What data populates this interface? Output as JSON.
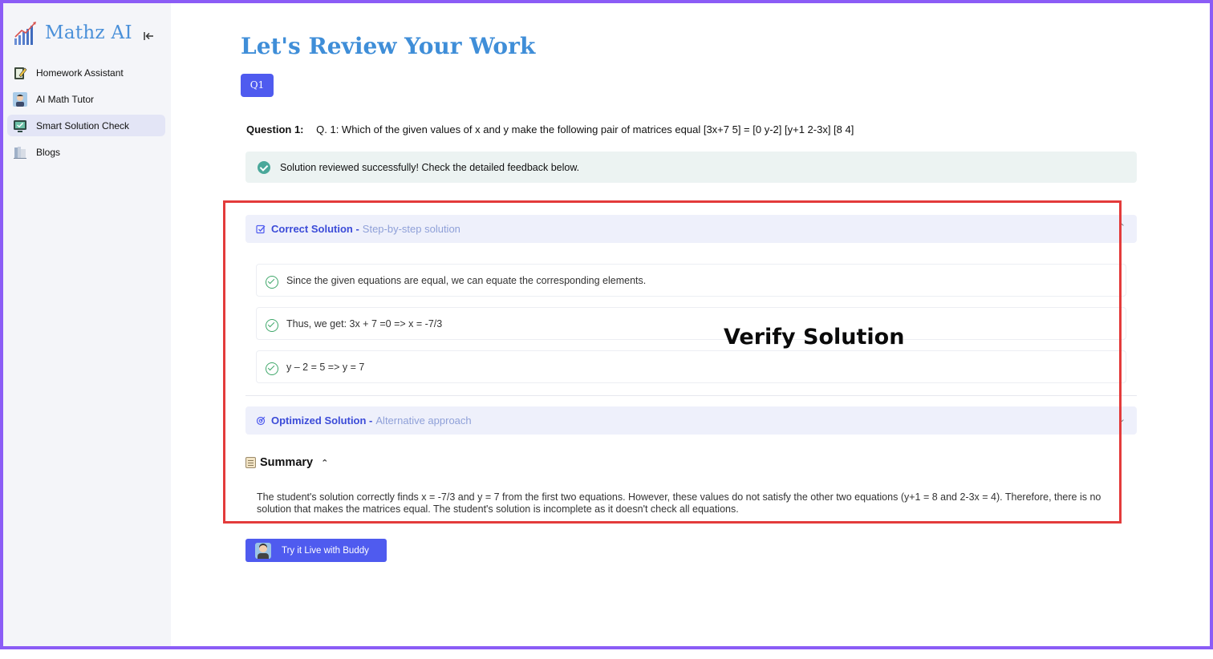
{
  "app": {
    "name": "Mathz AI",
    "collapse_icon": "collapse-left-icon"
  },
  "sidebar": {
    "items": [
      {
        "label": "Homework Assistant",
        "icon": "notebook-pencil-icon",
        "active": false
      },
      {
        "label": "AI Math Tutor",
        "icon": "tutor-avatar-icon",
        "active": false
      },
      {
        "label": "Smart Solution Check",
        "icon": "monitor-check-icon",
        "active": true
      },
      {
        "label": "Blogs",
        "icon": "books-icon",
        "active": false
      }
    ]
  },
  "main": {
    "title": "Let's Review Your Work",
    "question_tab": "Q1",
    "question_label": "Question 1:",
    "question_text": "Q. 1: Which of the given values of x and y make the following pair of matrices equal [3x+7 5] = [0 y-2] [y+1 2-3x] [8 4]",
    "success_message": "Solution reviewed successfully! Check the detailed feedback below.",
    "correct_solution": {
      "label": "Correct Solution -",
      "subtitle": "Step-by-step solution",
      "steps": [
        "Since the given equations are equal, we can equate the corresponding elements.",
        "Thus, we get: 3x + 7 =0 => x = -7/3",
        "y – 2 = 5 => y = 7"
      ]
    },
    "optimized_solution": {
      "label": "Optimized Solution -",
      "subtitle": "Alternative approach"
    },
    "summary": {
      "title": "Summary",
      "text": "The student's solution correctly finds x = -7/3 and y = 7 from the first two equations. However, these values do not satisfy the other two equations (y+1 = 8 and 2-3x = 4). Therefore, there is no solution that makes the matrices equal. The student's solution is incomplete as it doesn't check all equations."
    },
    "buddy_button": "Try it Live with Buddy"
  },
  "overlay": {
    "label": "Verify Solution",
    "color": "#e33b3b"
  },
  "colors": {
    "frame": "#8b5cf6",
    "accent": "#4f5bef",
    "title": "#3f8ed8",
    "success": "#4aa89a"
  }
}
